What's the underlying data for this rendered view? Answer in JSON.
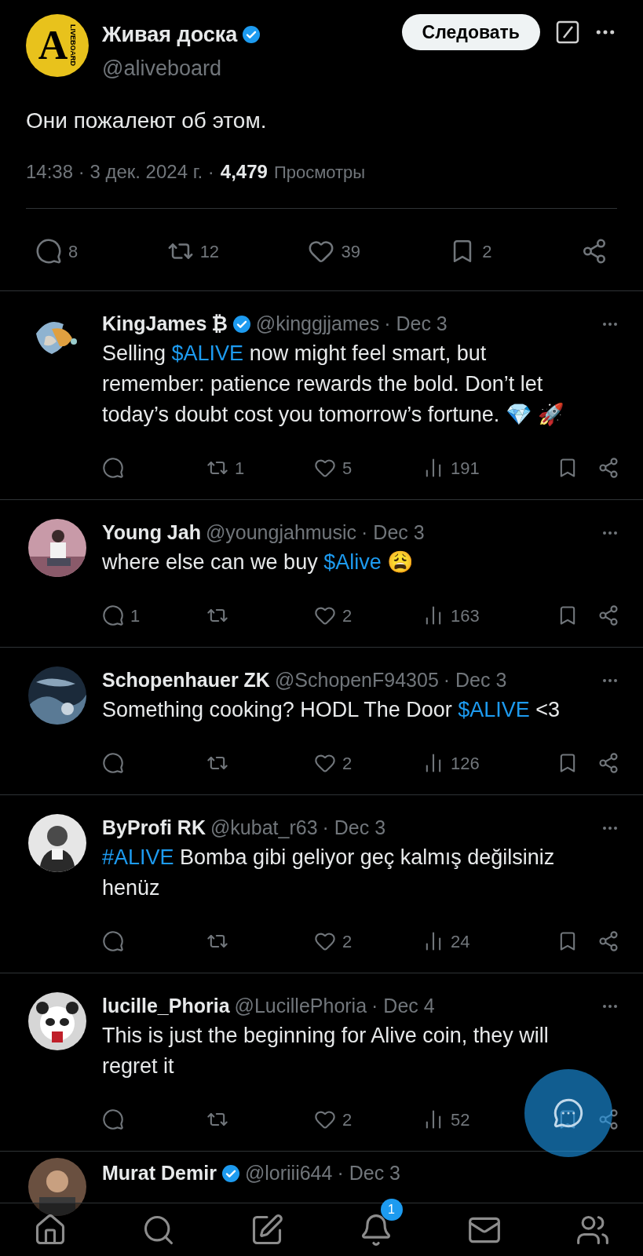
{
  "post": {
    "author": {
      "logo_letter": "A",
      "logo_word": "LIVEBOARD",
      "name": "Живая доска",
      "verified": true,
      "handle": "@aliveboard"
    },
    "follow_button": "Следовать",
    "text": "Они пожалеют об этом.",
    "time": "14:38 · 3 дек. 2024 г. ·",
    "views_count": "4,479",
    "views_label": "Просмотры",
    "stats": [
      {
        "kind": "reply",
        "count": "8"
      },
      {
        "kind": "repost",
        "count": "12"
      },
      {
        "kind": "like",
        "count": "39"
      },
      {
        "kind": "bookmark",
        "count": "2"
      },
      {
        "kind": "share"
      }
    ]
  },
  "replies": [
    {
      "name": "KingJames",
      "badge": "₿",
      "verified": true,
      "handle": "@kinggjjames",
      "date": "· Dec 3",
      "segments": [
        {
          "kind": "plain",
          "text": "Selling "
        },
        {
          "kind": "link",
          "text": "$ALIVE"
        },
        {
          "kind": "plain",
          "text": " now might feel smart, but remember: patience rewards the bold. Don’t let today’s doubt cost you tomorrow’s fortune. 💎 🚀"
        }
      ],
      "actions": {
        "reposts": "1",
        "likes": "5",
        "views": "191"
      }
    },
    {
      "name": "Young Jah",
      "verified": false,
      "handle": "@youngjahmusic",
      "date": "· Dec 3",
      "segments": [
        {
          "kind": "plain",
          "text": "where else can we buy "
        },
        {
          "kind": "link",
          "text": "$Alive"
        },
        {
          "kind": "plain",
          "text": " 😩"
        }
      ],
      "actions": {
        "replies": "1",
        "likes": "2",
        "views": "163"
      }
    },
    {
      "name": "Schopenhauer ZK",
      "verified": false,
      "handle": "@SchopenF94305",
      "date": "· Dec 3",
      "segments": [
        {
          "kind": "plain",
          "text": "Something cooking? HODL The Door "
        },
        {
          "kind": "link",
          "text": "$ALIVE"
        },
        {
          "kind": "plain",
          "text": " <3"
        }
      ],
      "actions": {
        "likes": "2",
        "views": "126"
      }
    },
    {
      "name": "ByProfi RK",
      "verified": false,
      "handle": "@kubat_r63",
      "date": "· Dec 3",
      "segments": [
        {
          "kind": "link",
          "text": "#ALIVE"
        },
        {
          "kind": "plain",
          "text": " Bomba gibi geliyor geç kalmış değilsiniz henüz"
        }
      ],
      "actions": {
        "likes": "2",
        "views": "24"
      }
    },
    {
      "name": "lucille_Phoria",
      "verified": false,
      "handle": "@LucillePhoria",
      "date": "· Dec 4",
      "segments": [
        {
          "kind": "plain",
          "text": "This is just the beginning for Alive coin, they will regret it"
        }
      ],
      "actions": {
        "likes": "2",
        "views": "52"
      }
    }
  ],
  "next_reply": {
    "name": "Murat Demir",
    "verified": true,
    "handle": "@loriii644",
    "date": "· Dec 3"
  },
  "bottom_nav": [
    {
      "kind": "home"
    },
    {
      "kind": "search"
    },
    {
      "kind": "compose"
    },
    {
      "kind": "notifications",
      "badge": "1"
    },
    {
      "kind": "messages"
    },
    {
      "kind": "communities"
    }
  ]
}
